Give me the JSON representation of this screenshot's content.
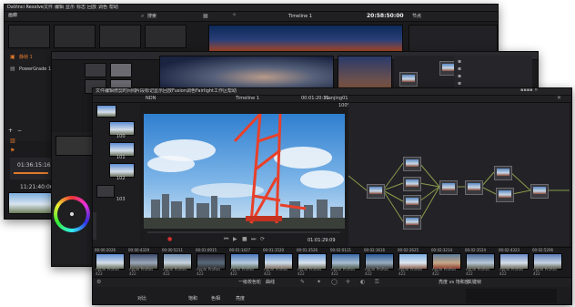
{
  "back_window": {
    "app_title": "DaVinci Resolve",
    "menu": [
      "文件",
      "编辑",
      "显示",
      "标志",
      "回放",
      "调色",
      "帮助"
    ],
    "gallery_tab": "画廊",
    "search_label": "搜索",
    "timeline_name": "Timeline 1",
    "timecode": "20:58:50:00",
    "nodes_label": "节点",
    "album_1": "静帧 1",
    "album_2": "PowerGrade 1",
    "tc_a": "01:36:15:16",
    "tc_b": "11:21:40:06",
    "add_symbol": "+",
    "minus_symbol": "−"
  },
  "mid_window": {},
  "front_window": {
    "menu": [
      "文件",
      "编辑",
      "修剪",
      "时间线",
      "片段",
      "标记",
      "显示",
      "回放",
      "Fusion",
      "调色",
      "Fairlight",
      "工作区",
      "帮助"
    ],
    "top_left_label": "NDN",
    "timeline_name": "Timeline 1",
    "top_timecode": "00:01:20:11",
    "clip_label": "Nanjing01",
    "zoom": "100%",
    "playhead_timecode": "01:01:29:09",
    "bin_clips": [
      {
        "num": "100"
      },
      {
        "num": "101"
      },
      {
        "num": "102"
      },
      {
        "num": "103"
      }
    ],
    "timeline_clips": [
      {
        "tc": "00:00:2026",
        "n": "01",
        "codec": "Apple ProRes 422"
      },
      {
        "tc": "00:00:4329",
        "n": "02",
        "codec": "Apple ProRes 422"
      },
      {
        "tc": "00:00:5211",
        "n": "03",
        "codec": "Apple ProRes 422"
      },
      {
        "tc": "00:01:0915",
        "n": "04",
        "codec": "Apple ProRes 422"
      },
      {
        "tc": "00:01:1427",
        "n": "05",
        "codec": "Apple ProRes 422"
      },
      {
        "tc": "00:01:1520",
        "n": "06",
        "codec": "Apple ProRes 422"
      },
      {
        "tc": "00:01:3526",
        "n": "07",
        "codec": "Apple ProRes 422"
      },
      {
        "tc": "00:02:0121",
        "n": "08",
        "codec": "Apple ProRes 422"
      },
      {
        "tc": "00:02:1616",
        "n": "09",
        "codec": "Apple ProRes 422"
      },
      {
        "tc": "00:02:2625",
        "n": "10",
        "codec": "Apple ProRes 422"
      },
      {
        "tc": "00:02:3214",
        "n": "11",
        "codec": "Apple ProRes 422"
      },
      {
        "tc": "00:02:3524",
        "n": "12",
        "codec": "Apple ProRes 422"
      },
      {
        "tc": "00:02:4323",
        "n": "13",
        "codec": "Apple ProRes 422"
      },
      {
        "tc": "00:02:5206",
        "n": "14",
        "codec": "Apple ProRes 422"
      }
    ],
    "bottom_labels": {
      "primary": "一级校色轮",
      "curves": "曲线",
      "tab_a": "亮度 vs 饱和度",
      "tab_b": "关键帧",
      "left_a": "对比",
      "left_b": "饱和",
      "left_c": "色相",
      "left_d": "亮度"
    }
  },
  "colors": {
    "accent_orange": "#e0782a",
    "crane_red": "#e8402a",
    "sky": "#3f8ed8",
    "panel": "#1b1b1d"
  }
}
